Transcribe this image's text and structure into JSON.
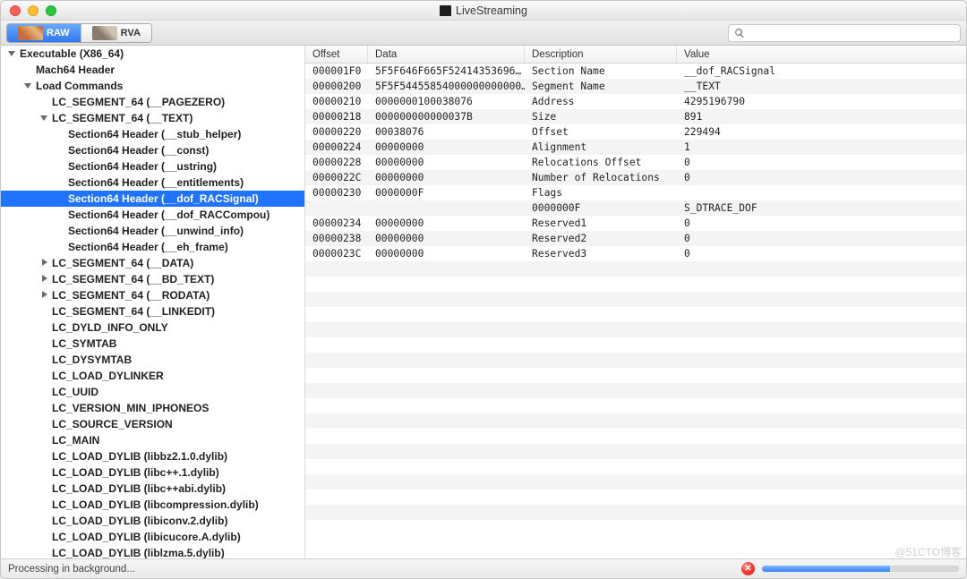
{
  "window": {
    "title": "LiveStreaming"
  },
  "toolbar": {
    "segments": [
      {
        "label": "RAW",
        "active": true
      },
      {
        "label": "RVA",
        "active": false
      }
    ],
    "search_placeholder": ""
  },
  "tree": [
    {
      "label": "Executable  (X86_64)",
      "depth": 0,
      "disclosure": "expanded"
    },
    {
      "label": "Mach64 Header",
      "depth": 1,
      "disclosure": "none"
    },
    {
      "label": "Load Commands",
      "depth": 1,
      "disclosure": "expanded"
    },
    {
      "label": "LC_SEGMENT_64 (__PAGEZERO)",
      "depth": 2,
      "disclosure": "none"
    },
    {
      "label": "LC_SEGMENT_64 (__TEXT)",
      "depth": 2,
      "disclosure": "expanded"
    },
    {
      "label": "Section64 Header (__stub_helper)",
      "depth": 3,
      "disclosure": "none"
    },
    {
      "label": "Section64 Header (__const)",
      "depth": 3,
      "disclosure": "none"
    },
    {
      "label": "Section64 Header (__ustring)",
      "depth": 3,
      "disclosure": "none"
    },
    {
      "label": "Section64 Header (__entitlements)",
      "depth": 3,
      "disclosure": "none"
    },
    {
      "label": "Section64 Header (__dof_RACSignal)",
      "depth": 3,
      "disclosure": "none",
      "selected": true
    },
    {
      "label": "Section64 Header (__dof_RACCompou)",
      "depth": 3,
      "disclosure": "none"
    },
    {
      "label": "Section64 Header (__unwind_info)",
      "depth": 3,
      "disclosure": "none"
    },
    {
      "label": "Section64 Header (__eh_frame)",
      "depth": 3,
      "disclosure": "none"
    },
    {
      "label": "LC_SEGMENT_64 (__DATA)",
      "depth": 2,
      "disclosure": "collapsed"
    },
    {
      "label": "LC_SEGMENT_64 (__BD_TEXT)",
      "depth": 2,
      "disclosure": "collapsed"
    },
    {
      "label": "LC_SEGMENT_64 (__RODATA)",
      "depth": 2,
      "disclosure": "collapsed"
    },
    {
      "label": "LC_SEGMENT_64 (__LINKEDIT)",
      "depth": 2,
      "disclosure": "none"
    },
    {
      "label": "LC_DYLD_INFO_ONLY",
      "depth": 2,
      "disclosure": "none"
    },
    {
      "label": "LC_SYMTAB",
      "depth": 2,
      "disclosure": "none"
    },
    {
      "label": "LC_DYSYMTAB",
      "depth": 2,
      "disclosure": "none"
    },
    {
      "label": "LC_LOAD_DYLINKER",
      "depth": 2,
      "disclosure": "none"
    },
    {
      "label": "LC_UUID",
      "depth": 2,
      "disclosure": "none"
    },
    {
      "label": "LC_VERSION_MIN_IPHONEOS",
      "depth": 2,
      "disclosure": "none"
    },
    {
      "label": "LC_SOURCE_VERSION",
      "depth": 2,
      "disclosure": "none"
    },
    {
      "label": "LC_MAIN",
      "depth": 2,
      "disclosure": "none"
    },
    {
      "label": "LC_LOAD_DYLIB (libbz2.1.0.dylib)",
      "depth": 2,
      "disclosure": "none"
    },
    {
      "label": "LC_LOAD_DYLIB (libc++.1.dylib)",
      "depth": 2,
      "disclosure": "none"
    },
    {
      "label": "LC_LOAD_DYLIB (libc++abi.dylib)",
      "depth": 2,
      "disclosure": "none"
    },
    {
      "label": "LC_LOAD_DYLIB (libcompression.dylib)",
      "depth": 2,
      "disclosure": "none"
    },
    {
      "label": "LC_LOAD_DYLIB (libiconv.2.dylib)",
      "depth": 2,
      "disclosure": "none"
    },
    {
      "label": "LC_LOAD_DYLIB (libicucore.A.dylib)",
      "depth": 2,
      "disclosure": "none"
    },
    {
      "label": "LC_LOAD_DYLIB (liblzma.5.dylib)",
      "depth": 2,
      "disclosure": "none"
    }
  ],
  "columns": {
    "offset": "Offset",
    "data": "Data",
    "desc": "Description",
    "value": "Value"
  },
  "rows": [
    {
      "offset": "000001F0",
      "data": "5F5F646F665F52414353696…",
      "desc": "Section Name",
      "value": "__dof_RACSignal"
    },
    {
      "offset": "00000200",
      "data": "5F5F54455854000000000000…",
      "desc": "Segment Name",
      "value": "__TEXT"
    },
    {
      "offset": "00000210",
      "data": "0000000100038076",
      "desc": "Address",
      "value": "4295196790"
    },
    {
      "offset": "00000218",
      "data": "000000000000037B",
      "desc": "Size",
      "value": "891"
    },
    {
      "offset": "00000220",
      "data": "00038076",
      "desc": "Offset",
      "value": "229494"
    },
    {
      "offset": "00000224",
      "data": "00000000",
      "desc": "Alignment",
      "value": "1"
    },
    {
      "offset": "00000228",
      "data": "00000000",
      "desc": "Relocations Offset",
      "value": "0"
    },
    {
      "offset": "0000022C",
      "data": "00000000",
      "desc": "Number of Relocations",
      "value": "0"
    },
    {
      "offset": "00000230",
      "data": "0000000F",
      "desc": "Flags",
      "value": ""
    },
    {
      "offset": "",
      "data": "",
      "desc": "0000000F",
      "value": "S_DTRACE_DOF"
    },
    {
      "offset": "00000234",
      "data": "00000000",
      "desc": "Reserved1",
      "value": "0"
    },
    {
      "offset": "00000238",
      "data": "00000000",
      "desc": "Reserved2",
      "value": "0"
    },
    {
      "offset": "0000023C",
      "data": "00000000",
      "desc": "Reserved3",
      "value": "0"
    }
  ],
  "padding_rows": 18,
  "status": {
    "text": "Processing in background...",
    "progress_percent": 65
  },
  "watermark": "@51CTO博客"
}
